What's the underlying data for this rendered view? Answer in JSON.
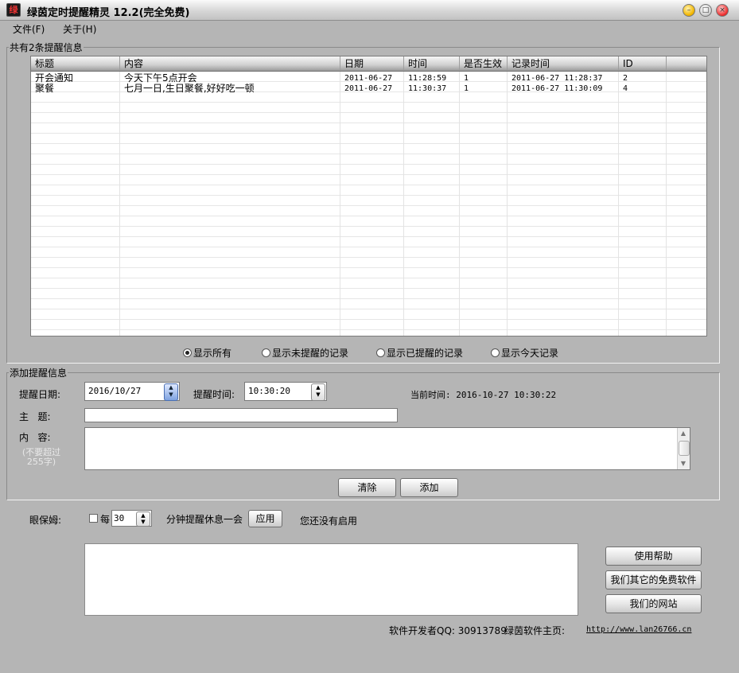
{
  "window": {
    "title": "绿茵定时提醒精灵 12.2(完全免费)",
    "icon_text": "绿"
  },
  "menu": [
    {
      "label": "文件(F)"
    },
    {
      "label": "关于(H)"
    }
  ],
  "list_group": {
    "label": "共有2条提醒信息"
  },
  "table": {
    "columns": [
      "标题",
      "内容",
      "日期",
      "时间",
      "是否生效",
      "记录时间",
      "ID"
    ],
    "rows": [
      [
        "开会通知",
        "今天下午5点开会",
        "2011-06-27",
        "11:28:59",
        "1",
        "2011-06-27 11:28:37",
        "2"
      ],
      [
        "聚餐",
        "七月一日,生日聚餐,好好吃一顿",
        "2011-06-27",
        "11:30:37",
        "1",
        "2011-06-27 11:30:09",
        "4"
      ]
    ]
  },
  "filters": {
    "selected": "all",
    "options": [
      {
        "id": "all",
        "label": "显示所有"
      },
      {
        "id": "pending",
        "label": "显示未提醒的记录"
      },
      {
        "id": "done",
        "label": "显示已提醒的记录"
      },
      {
        "id": "today",
        "label": "显示今天记录"
      }
    ]
  },
  "add_group": {
    "label": "添加提醒信息",
    "date_label": "提醒日期:",
    "date_value": "2016/10/27",
    "time_label": "提醒时间:",
    "time_value": "10:30:20",
    "current_time_label": "当前时间: 2016-10-27 10:30:22",
    "subject_label": "主   题:",
    "subject_value": "",
    "content_label": "内   容:",
    "content_hint": "(不要超过255字)",
    "content_value": "",
    "clear_button": "清除",
    "add_button": "添加"
  },
  "eye_care": {
    "label": "眼保姆:",
    "checked": false,
    "every_label": "每",
    "minutes_value": "30",
    "suffix_label": "分钟提醒休息一会",
    "apply_button": "应用",
    "status": "您还没有启用"
  },
  "side_buttons": {
    "help": "使用帮助",
    "other_software": "我们其它的免费软件",
    "website": "我们的网站"
  },
  "footer": {
    "qq_label": "软件开发者QQ: 30913789",
    "homepage_label": "绿茵软件主页:",
    "homepage_url": "http://www.lan26766.cn"
  }
}
